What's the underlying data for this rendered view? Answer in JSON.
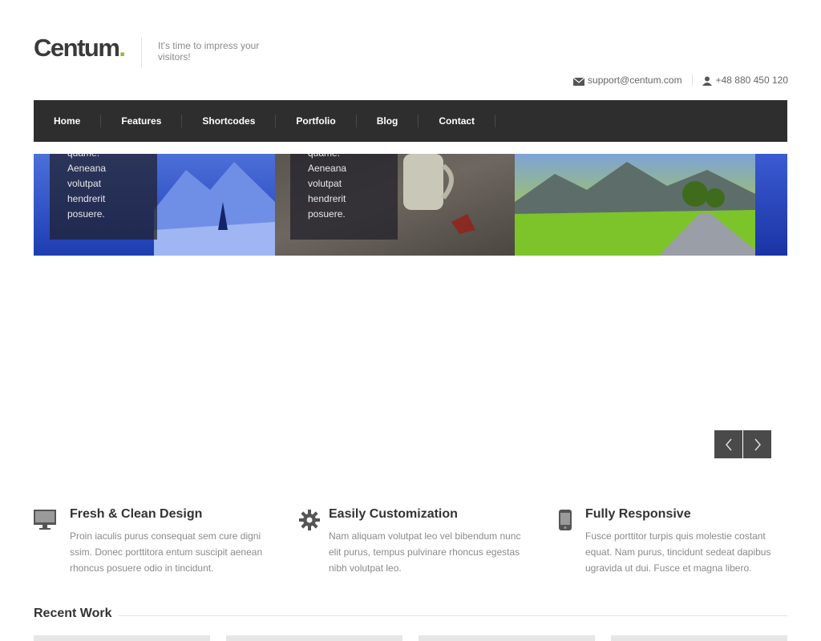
{
  "header": {
    "logo_text": "Centum",
    "logo_dot": ".",
    "tagline": "It's time to impress your visitors!",
    "email": "support@centum.com",
    "phone": "+48 880 450 120"
  },
  "nav": {
    "items": [
      "Home",
      "Features",
      "Shortcodes",
      "Portfolio",
      "Blog",
      "Contact"
    ]
  },
  "slider": {
    "captions": [
      [
        "quame.",
        "Aeneana",
        "volutpat",
        "hendrerit",
        "posuere."
      ],
      [
        "quame.",
        "Aeneana",
        "volutpat",
        "hendrerit",
        "posuere."
      ]
    ]
  },
  "features": [
    {
      "icon": "monitor-icon",
      "title": "Fresh & Clean Design",
      "text": "Proin iaculis purus consequat sem cure digni ssim. Donec porttitora entum suscipit aenean rhoncus posuere odio in tincidunt."
    },
    {
      "icon": "gear-icon",
      "title": "Easily Customization",
      "text": "Nam aliquam volutpat leo vel bibendum nunc elit purus, tempus pulvinare rhoncus egestas nibh volutpat leo."
    },
    {
      "icon": "phone-icon",
      "title": "Fully Responsive",
      "text": "Fusce porttitor turpis quis molestie costant equat. Nam purus, tincidunt sedeat dapibus ugravida ut dui. Fusce et magna libero."
    }
  ],
  "recent_work": {
    "title": "Recent Work"
  },
  "colors": {
    "accent": "#8cba3c",
    "nav_bg": "#2e2e2e",
    "arrow_bg": "#4a4a4a"
  }
}
